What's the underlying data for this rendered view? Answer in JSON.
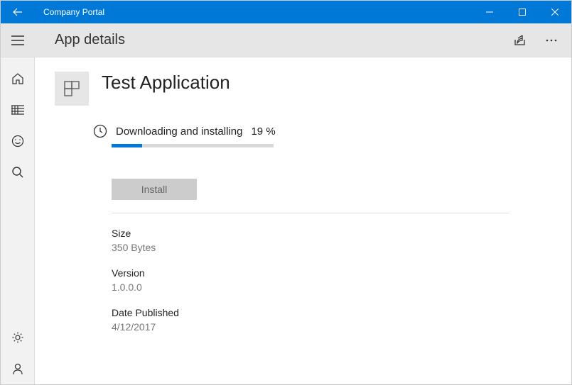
{
  "titlebar": {
    "title": "Company Portal"
  },
  "header": {
    "title": "App details"
  },
  "app": {
    "name": "Test Application",
    "status_label": "Downloading and installing",
    "progress_text": "19 %",
    "progress_percent": 19,
    "install_button": "Install",
    "details": {
      "size": {
        "label": "Size",
        "value": "350 Bytes"
      },
      "version": {
        "label": "Version",
        "value": "1.0.0.0"
      },
      "published": {
        "label": "Date Published",
        "value": "4/12/2017"
      }
    }
  }
}
